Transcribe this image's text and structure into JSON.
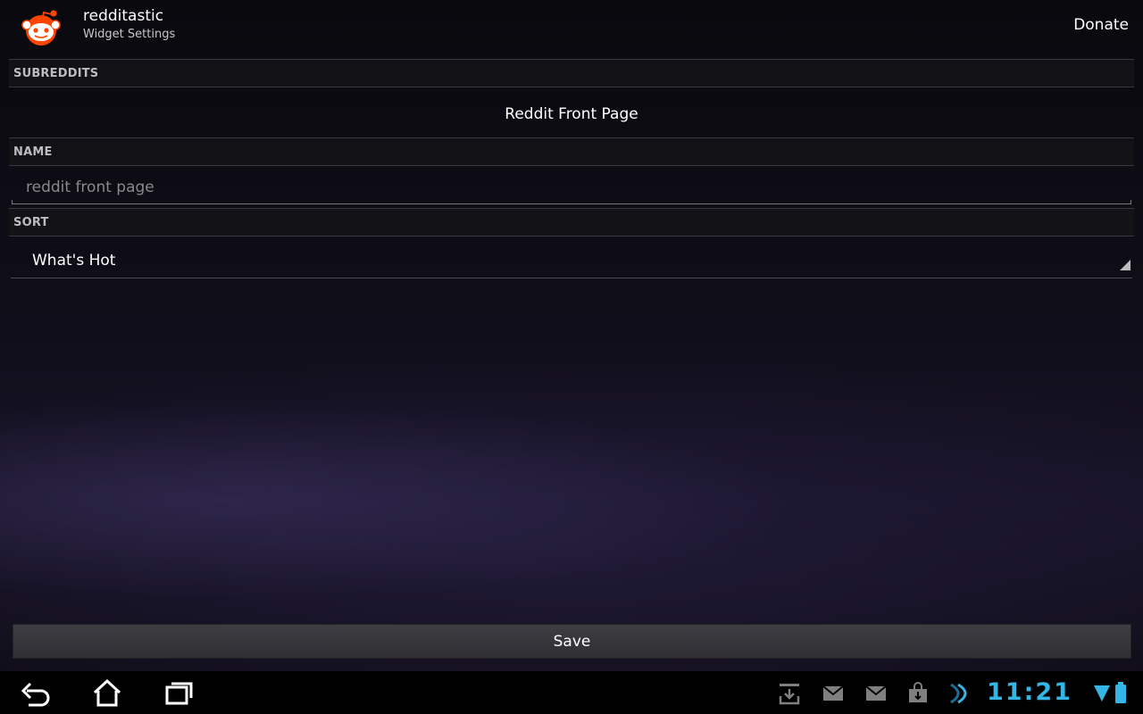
{
  "action_bar": {
    "app_title": "redditastic",
    "app_subtitle": "Widget Settings",
    "donate_label": "Donate",
    "icon": "reddit-alien-icon"
  },
  "sections": {
    "subreddits_header": "SUBREDDITS",
    "subreddit_value": "Reddit Front Page",
    "name_header": "NAME",
    "name_value": "",
    "name_placeholder": "reddit front page",
    "sort_header": "SORT",
    "sort_value": "What's Hot"
  },
  "save_label": "Save",
  "system_bar": {
    "clock": "11:21",
    "nav_icons": [
      "back-icon",
      "home-icon",
      "recent-apps-icon"
    ],
    "notification_icons": [
      "download-icon",
      "gmail-icon",
      "gmail-icon",
      "market-icon",
      "sync-arrow-icon"
    ],
    "status_icons": [
      "wifi-icon",
      "battery-icon"
    ]
  },
  "colors": {
    "accent": "#33b5e5",
    "reddit_orange": "#ff4500"
  }
}
